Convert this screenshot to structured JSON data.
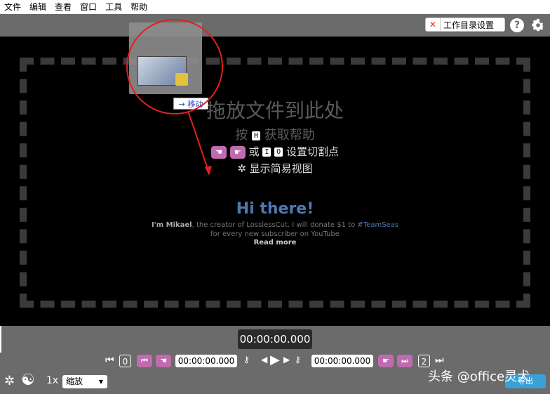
{
  "menu": [
    "文件",
    "编辑",
    "查看",
    "窗口",
    "工具",
    "帮助"
  ],
  "topbar": {
    "workdir_close": "✕",
    "workdir_label": "工作目录设置",
    "help": "?"
  },
  "drop": {
    "title": "拖放文件到此处",
    "help_prefix": "按",
    "help_key": "H",
    "help_suffix": "获取帮助",
    "cut_or": "或",
    "cut_key_i": "I",
    "cut_key_o": "O",
    "cut_suffix": "设置切割点",
    "simple_label": "显示简易视图",
    "hi": "Hi there!",
    "donate_name": "I'm Mikael",
    "donate_text": ", the creator of LosslessCut. I will donate $1 to ",
    "donate_tag": "#TeamSeas",
    "donate_line2": "for every new subscriber on YouTube",
    "read_more": "Read more"
  },
  "drag": {
    "move_label": "移动"
  },
  "timeline": {
    "current_time": "00:00:00.000"
  },
  "controls": {
    "start_num": "0",
    "end_num": "2",
    "cut_start": "00:00:00.000",
    "cut_end": "00:00:00.000",
    "speed": "1x",
    "zoom": "缩放",
    "export": "导出"
  },
  "watermark": "头条 @office灵犬"
}
